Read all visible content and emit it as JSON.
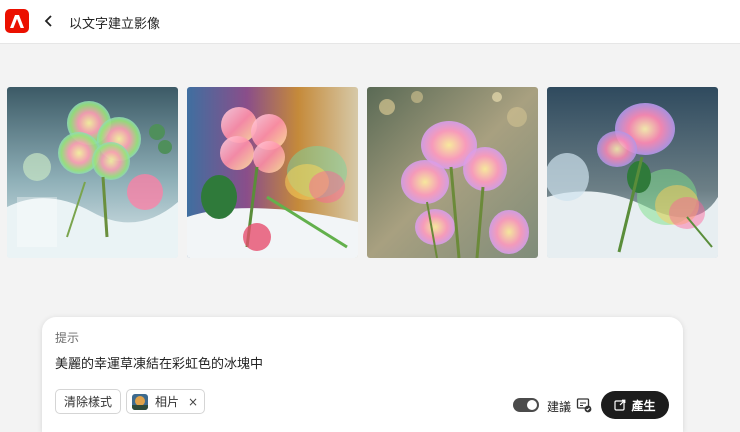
{
  "header": {
    "logo_icon": "adobe-logo-icon",
    "back_icon": "chevron-left-icon",
    "title": "以文字建立影像",
    "accent": "#eb1000"
  },
  "gallery": {
    "images": [
      {
        "alt": "rainbow clover frozen in ice 1"
      },
      {
        "alt": "rainbow clover frozen in ice 2"
      },
      {
        "alt": "rainbow clover frozen in ice 3"
      },
      {
        "alt": "rainbow clover frozen in ice 4"
      }
    ]
  },
  "prompt": {
    "label": "提示",
    "text": "美麗的幸運草凍結在彩虹色的冰塊中",
    "clear_button": "清除樣式",
    "style_chip": "相片",
    "style_chip_remove": "×",
    "suggest_label": "建議",
    "suggest_enabled": true,
    "generate_button": "產生"
  }
}
